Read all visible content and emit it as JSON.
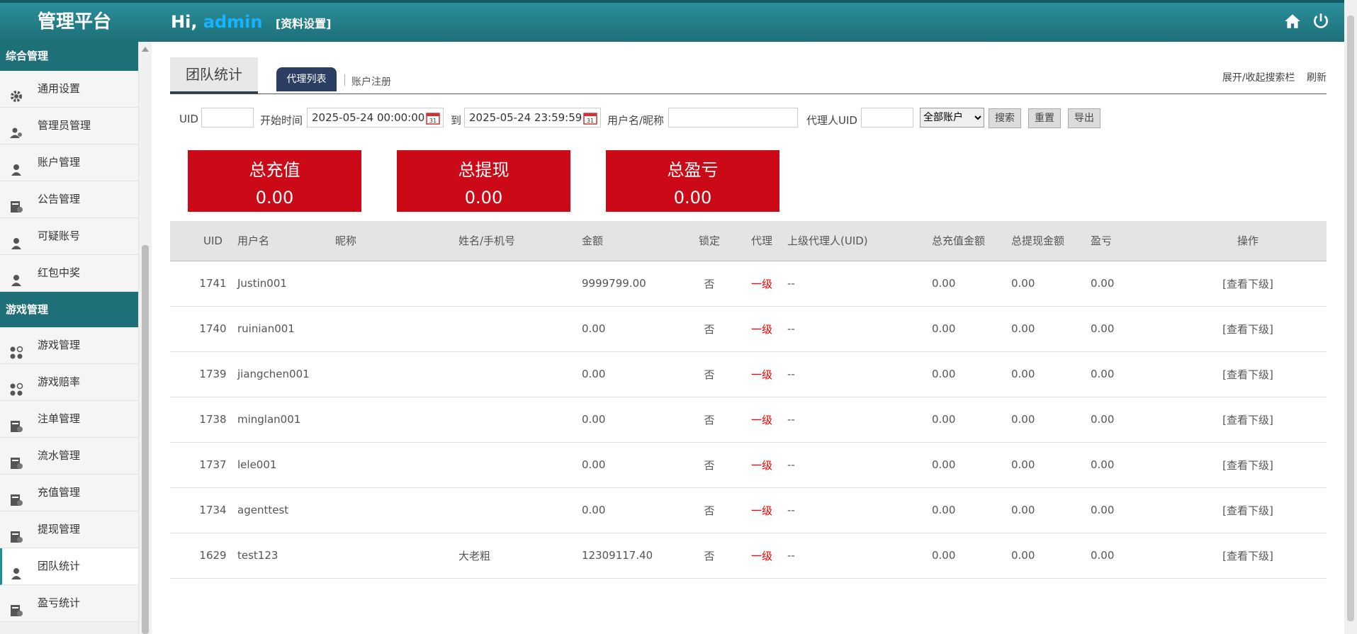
{
  "header": {
    "brand": "管理平台",
    "greeting": "Hi,",
    "username": "admin",
    "profile_link": "[资料设置]",
    "icons": [
      "home-icon",
      "power-icon"
    ]
  },
  "sidebar": {
    "section1": "综合管理",
    "items1": [
      {
        "label": "通用设置",
        "icon": "gear-icon"
      },
      {
        "label": "管理员管理",
        "icon": "users-icon"
      },
      {
        "label": "账户管理",
        "icon": "user-icon"
      },
      {
        "label": "公告管理",
        "icon": "form-icon"
      },
      {
        "label": "可疑账号",
        "icon": "user-icon"
      },
      {
        "label": "红包中奖",
        "icon": "user-icon"
      }
    ],
    "section2": "游戏管理",
    "items2": [
      {
        "label": "游戏管理",
        "icon": "grid-icon"
      },
      {
        "label": "游戏赔率",
        "icon": "grid-icon"
      },
      {
        "label": "注单管理",
        "icon": "form-icon"
      },
      {
        "label": "流水管理",
        "icon": "form-icon"
      },
      {
        "label": "充值管理",
        "icon": "form-icon"
      },
      {
        "label": "提现管理",
        "icon": "form-icon"
      },
      {
        "label": "团队统计",
        "icon": "user-icon",
        "active": true
      },
      {
        "label": "盈亏统计",
        "icon": "form-icon"
      }
    ]
  },
  "page": {
    "title": "团队统计",
    "tab_active": "代理列表",
    "tab_other": "账户注册",
    "toggle_search": "展开/收起搜索栏",
    "refresh": "刷新"
  },
  "filters": {
    "uid_label": "UID",
    "uid_value": "",
    "start_label": "开始时间",
    "start_value": "2025-05-24 00:00:00",
    "to_label": "到",
    "end_value": "2025-05-24 23:59:59",
    "name_label": "用户名/昵称",
    "name_value": "",
    "agent_label": "代理人UID",
    "agent_value": "",
    "account_select": "全部账户",
    "search_btn": "搜索",
    "reset_btn": "重置",
    "export_btn": "导出"
  },
  "stats": [
    {
      "title": "总充值",
      "value": "0.00"
    },
    {
      "title": "总提现",
      "value": "0.00"
    },
    {
      "title": "总盈亏",
      "value": "0.00"
    }
  ],
  "table": {
    "columns": [
      "UID",
      "用户名",
      "昵称",
      "姓名/手机号",
      "金额",
      "锁定",
      "代理",
      "上级代理人(UID)",
      "总充值金额",
      "总提现金额",
      "盈亏",
      "操作"
    ],
    "rows": [
      {
        "uid": "1741",
        "username": "Justin001",
        "nickname": "",
        "name": "",
        "amount": "9999799.00",
        "locked": "否",
        "agent": "一级",
        "parent": "--",
        "recharge": "0.00",
        "withdraw": "0.00",
        "pl": "0.00",
        "action": "[查看下级]"
      },
      {
        "uid": "1740",
        "username": "ruinian001",
        "nickname": "",
        "name": "",
        "amount": "0.00",
        "locked": "否",
        "agent": "一级",
        "parent": "--",
        "recharge": "0.00",
        "withdraw": "0.00",
        "pl": "0.00",
        "action": "[查看下级]"
      },
      {
        "uid": "1739",
        "username": "jiangchen001",
        "nickname": "",
        "name": "",
        "amount": "0.00",
        "locked": "否",
        "agent": "一级",
        "parent": "--",
        "recharge": "0.00",
        "withdraw": "0.00",
        "pl": "0.00",
        "action": "[查看下级]"
      },
      {
        "uid": "1738",
        "username": "minglan001",
        "nickname": "",
        "name": "",
        "amount": "0.00",
        "locked": "否",
        "agent": "一级",
        "parent": "--",
        "recharge": "0.00",
        "withdraw": "0.00",
        "pl": "0.00",
        "action": "[查看下级]"
      },
      {
        "uid": "1737",
        "username": "lele001",
        "nickname": "",
        "name": "",
        "amount": "0.00",
        "locked": "否",
        "agent": "一级",
        "parent": "--",
        "recharge": "0.00",
        "withdraw": "0.00",
        "pl": "0.00",
        "action": "[查看下级]"
      },
      {
        "uid": "1734",
        "username": "agenttest",
        "nickname": "",
        "name": "",
        "amount": "0.00",
        "locked": "否",
        "agent": "一级",
        "parent": "--",
        "recharge": "0.00",
        "withdraw": "0.00",
        "pl": "0.00",
        "action": "[查看下级]"
      },
      {
        "uid": "1629",
        "username": "test123",
        "nickname": "",
        "name": "大老粗",
        "amount": "12309117.40",
        "locked": "否",
        "agent": "一级",
        "parent": "--",
        "recharge": "0.00",
        "withdraw": "0.00",
        "pl": "0.00",
        "action": "[查看下级]"
      }
    ]
  },
  "colors": {
    "header_teal": "#1d6f78",
    "stat_red": "#cc0a17",
    "tab_navy": "#2c3e63",
    "agent_red": "#e00000"
  }
}
